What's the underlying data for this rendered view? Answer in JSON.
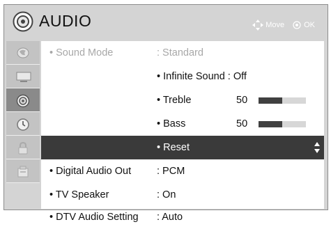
{
  "header": {
    "title": "AUDIO",
    "icon": "audio-icon",
    "move_hint": "Move",
    "ok_hint": "OK"
  },
  "sidebar": {
    "items": [
      {
        "icon": "picture-icon"
      },
      {
        "icon": "screen-icon"
      },
      {
        "icon": "audio-icon",
        "active": true
      },
      {
        "icon": "time-icon"
      },
      {
        "icon": "lock-icon"
      },
      {
        "icon": "option-icon"
      }
    ]
  },
  "menu": {
    "sound_mode": {
      "label": "• Sound Mode",
      "value": ": Standard"
    },
    "infinite_sound": {
      "label": "• Infinite Sound : Off"
    },
    "treble": {
      "label": "• Treble",
      "value": "50",
      "level": 0.5
    },
    "bass": {
      "label": "• Bass",
      "value": "50",
      "level": 0.5
    },
    "reset": {
      "label": "• Reset"
    },
    "digital_audio_out": {
      "label": "• Digital Audio Out",
      "value": ": PCM"
    },
    "tv_speaker": {
      "label": "• TV Speaker",
      "value": ": On"
    },
    "dtv_audio": {
      "label": "• DTV Audio Setting",
      "value": ": Auto"
    }
  },
  "colors": {
    "selected_row": "#3a3a3a",
    "frame": "#d4d4d4",
    "active_tab": "#8a8a8a",
    "disabled_text": "#a8a8a8"
  }
}
